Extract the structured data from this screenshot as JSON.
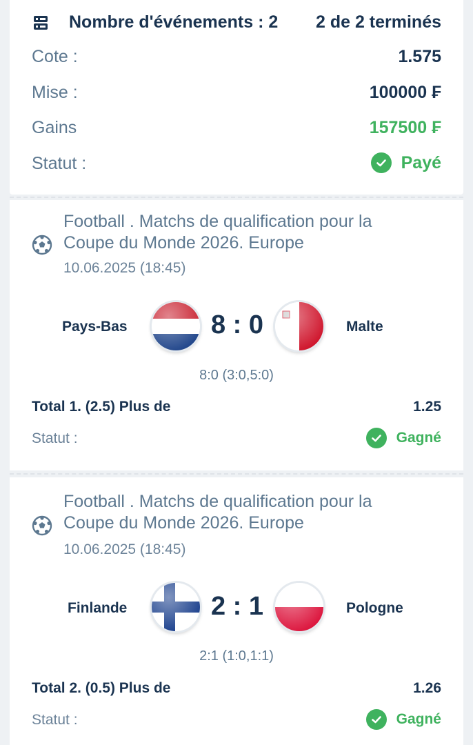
{
  "summary": {
    "events_label": "Nombre d'événements : 2",
    "finished_label": "2 de 2 terminés",
    "rows": [
      {
        "label": "Cote :",
        "value": "1.575"
      },
      {
        "label": "Mise :",
        "value": "100000 ₣"
      },
      {
        "label": "Gains",
        "value": "157500 ₣"
      }
    ],
    "status_label": "Statut :",
    "status_value": "Payé"
  },
  "events": [
    {
      "league": "Football . Matchs de qualification pour la Coupe du Monde 2026. Europe",
      "date": "10.06.2025 (18:45)",
      "home": "Pays-Bas",
      "away": "Malte",
      "score": "8 : 0",
      "detail": "8:0 (3:0,5:0)",
      "market": "Total 1. (2.5) Plus de",
      "odd": "1.25",
      "status_label": "Statut :",
      "status_value": "Gagné"
    },
    {
      "league": "Football . Matchs de qualification pour la Coupe du Monde 2026. Europe",
      "date": "10.06.2025 (18:45)",
      "home": "Finlande",
      "away": "Pologne",
      "score": "2 : 1",
      "detail": "2:1 (1:0,1:1)",
      "market": "Total 2. (0.5) Plus de",
      "odd": "1.26",
      "status_label": "Statut :",
      "status_value": "Gagné"
    }
  ],
  "colors": {
    "background": "#eef1f4",
    "text_dark": "#1a3350",
    "text_muted": "#5d7890",
    "success": "#3fb25e"
  },
  "icons": {
    "summary": "events-list-icon",
    "sport": "football-icon",
    "status": "check-circle-icon"
  }
}
